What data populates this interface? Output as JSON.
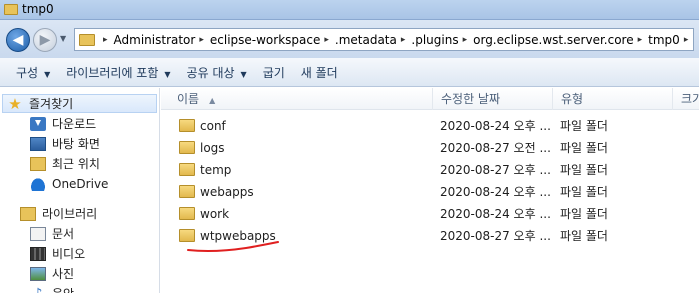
{
  "window": {
    "title": "tmp0"
  },
  "address": {
    "crumbs": [
      "Administrator",
      "eclipse-workspace",
      ".metadata",
      ".plugins",
      "org.eclipse.wst.server.core",
      "tmp0"
    ]
  },
  "toolbar": {
    "organize": "구성",
    "include_library": "라이브러리에 포함",
    "share_with": "공유 대상",
    "burn": "굽기",
    "new_folder": "새 폴더"
  },
  "nav": {
    "favorites": "즐겨찾기",
    "downloads": "다운로드",
    "desktop": "바탕 화면",
    "recent": "최근 위치",
    "onedrive": "OneDrive",
    "libraries": "라이브러리",
    "documents": "문서",
    "videos": "비디오",
    "pictures": "사진",
    "music": "음악"
  },
  "columns": {
    "name": "이름",
    "modified": "수정한 날짜",
    "type": "유형",
    "size": "크기"
  },
  "files": [
    {
      "name": "conf",
      "modified": "2020-08-24 오후 ...",
      "type": "파일 폴더"
    },
    {
      "name": "logs",
      "modified": "2020-08-27 오전 ...",
      "type": "파일 폴더"
    },
    {
      "name": "temp",
      "modified": "2020-08-27 오후 ...",
      "type": "파일 폴더"
    },
    {
      "name": "webapps",
      "modified": "2020-08-24 오후 ...",
      "type": "파일 폴더"
    },
    {
      "name": "work",
      "modified": "2020-08-24 오후 ...",
      "type": "파일 폴더"
    },
    {
      "name": "wtpwebapps",
      "modified": "2020-08-27 오후 ...",
      "type": "파일 폴더"
    }
  ],
  "annotation": {
    "color": "#e02020"
  }
}
